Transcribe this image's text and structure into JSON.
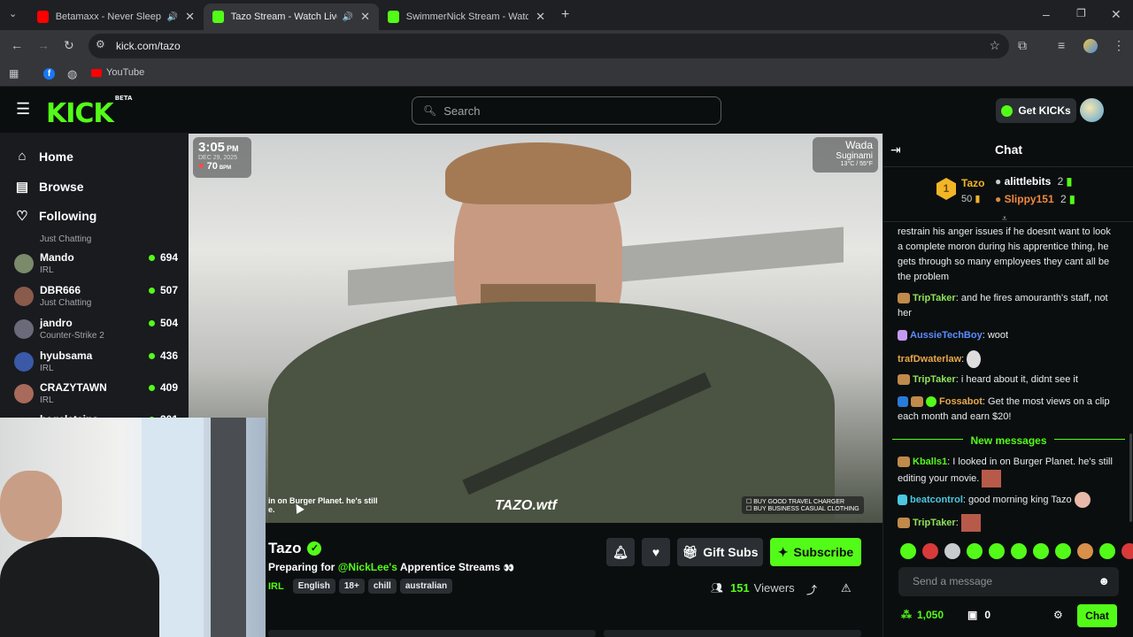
{
  "browser": {
    "tabs": [
      {
        "title": "Betamaxx - Never Sleep Ag",
        "favicon_color": "#ff0000"
      },
      {
        "title": "Tazo Stream - Watch Live o",
        "favicon_color": "#53fc18"
      },
      {
        "title": "SwimmerNick Stream - Watch L",
        "favicon_color": "#53fc18"
      }
    ],
    "url": "kick.com/tazo",
    "bookmarks": [
      {
        "label": "YouTube"
      }
    ]
  },
  "header": {
    "logo": "KICK",
    "logo_badge": "BETA",
    "search_placeholder": "Search",
    "get_kicks_label": "Get KICKs"
  },
  "sidebar": {
    "nav": [
      {
        "label": "Home",
        "icon": "home-icon"
      },
      {
        "label": "Browse",
        "icon": "browse-icon"
      },
      {
        "label": "Following",
        "icon": "heart-icon"
      }
    ],
    "partial_category_top": "Just Chatting",
    "channels": [
      {
        "name": "Mando",
        "category": "IRL",
        "viewers": "694",
        "color": "#7a8a6a"
      },
      {
        "name": "DBR666",
        "category": "Just Chatting",
        "viewers": "507",
        "color": "#8a5a4a"
      },
      {
        "name": "jandro",
        "category": "Counter-Strike 2",
        "viewers": "504",
        "color": "#6a6a7a"
      },
      {
        "name": "hyubsama",
        "category": "IRL",
        "viewers": "436",
        "color": "#3a5aa8"
      },
      {
        "name": "CRAZYTAWN",
        "category": "IRL",
        "viewers": "409",
        "color": "#a86a5a"
      }
    ],
    "partial_channel_bottom": {
      "name": "bagelstains",
      "viewers": "301"
    }
  },
  "video": {
    "overlay_time": "3:05",
    "overlay_ampm": "PM",
    "overlay_date": "DEC 29, 2025",
    "overlay_bpm": "70",
    "overlay_bpm_unit": "BPM",
    "overlay_location": "Wada",
    "overlay_city": "Suginami",
    "overlay_temp": "13°C / 55°F",
    "overlay_chat_line1": "in on Burger Planet. he's still",
    "overlay_chat_line2": "e.",
    "overlay_watermark": "TAZO.wtf",
    "overlay_tasks": [
      "BUY GOOD TRAVEL CHARGER",
      "BUY BUSINESS CASUAL CLOTHING"
    ]
  },
  "stream": {
    "streamer": "Tazo",
    "title_prefix": "Preparing for",
    "title_mention": "@NickLee's",
    "title_suffix": "Apprentice Streams",
    "category": "IRL",
    "tags": [
      "English",
      "18+",
      "chill",
      "australian"
    ],
    "viewers_count": "151",
    "viewers_label": "Viewers",
    "gift_subs_label": "Gift Subs",
    "subscribe_label": "Subscribe"
  },
  "chat": {
    "title": "Chat",
    "leaderboard": {
      "top_name": "Tazo",
      "top_count": "50",
      "entries": [
        {
          "name": "alittlebits",
          "count": "2"
        },
        {
          "name": "Slippy151",
          "count": "2"
        }
      ]
    },
    "messages": [
      {
        "user": "",
        "text": "restrain his anger issues if he doesnt want to look a complete moron during his apprentice thing, he gets through so many employees they cant all be the problem",
        "color": "#e9ecef"
      },
      {
        "user": "TripTaker",
        "text": "and he fires amouranth's staff, not her",
        "color": "#8fe35a"
      },
      {
        "user": "AussieTechBoy",
        "text": "woot",
        "color": "#5a8dff"
      },
      {
        "user": "trafDwaterlaw",
        "text": "",
        "color": "#e9a84a"
      },
      {
        "user": "TripTaker",
        "text": "i heard about it, didnt see it",
        "color": "#8fe35a"
      },
      {
        "user": "Fossabot",
        "text": "Get the most views on a clip each month and earn $20!",
        "color": "#e9a84a"
      }
    ],
    "new_messages_label": "New messages",
    "new_messages": [
      {
        "user": "Kballs1",
        "text": "I looked in on Burger Planet. he's still editing your movie.",
        "color": "#53fc18"
      },
      {
        "user": "beatcontrol",
        "text": "good morning king Tazo",
        "color": "#4ac8e0"
      },
      {
        "user": "TripTaker",
        "text": "",
        "color": "#8fe35a"
      }
    ],
    "input_placeholder": "Send a message",
    "points": "1,050",
    "gifts": "0",
    "chat_button": "Chat"
  },
  "colors": {
    "brand": "#53fc18",
    "background": "#0b0e0f",
    "sidebar": "#191b1f"
  }
}
